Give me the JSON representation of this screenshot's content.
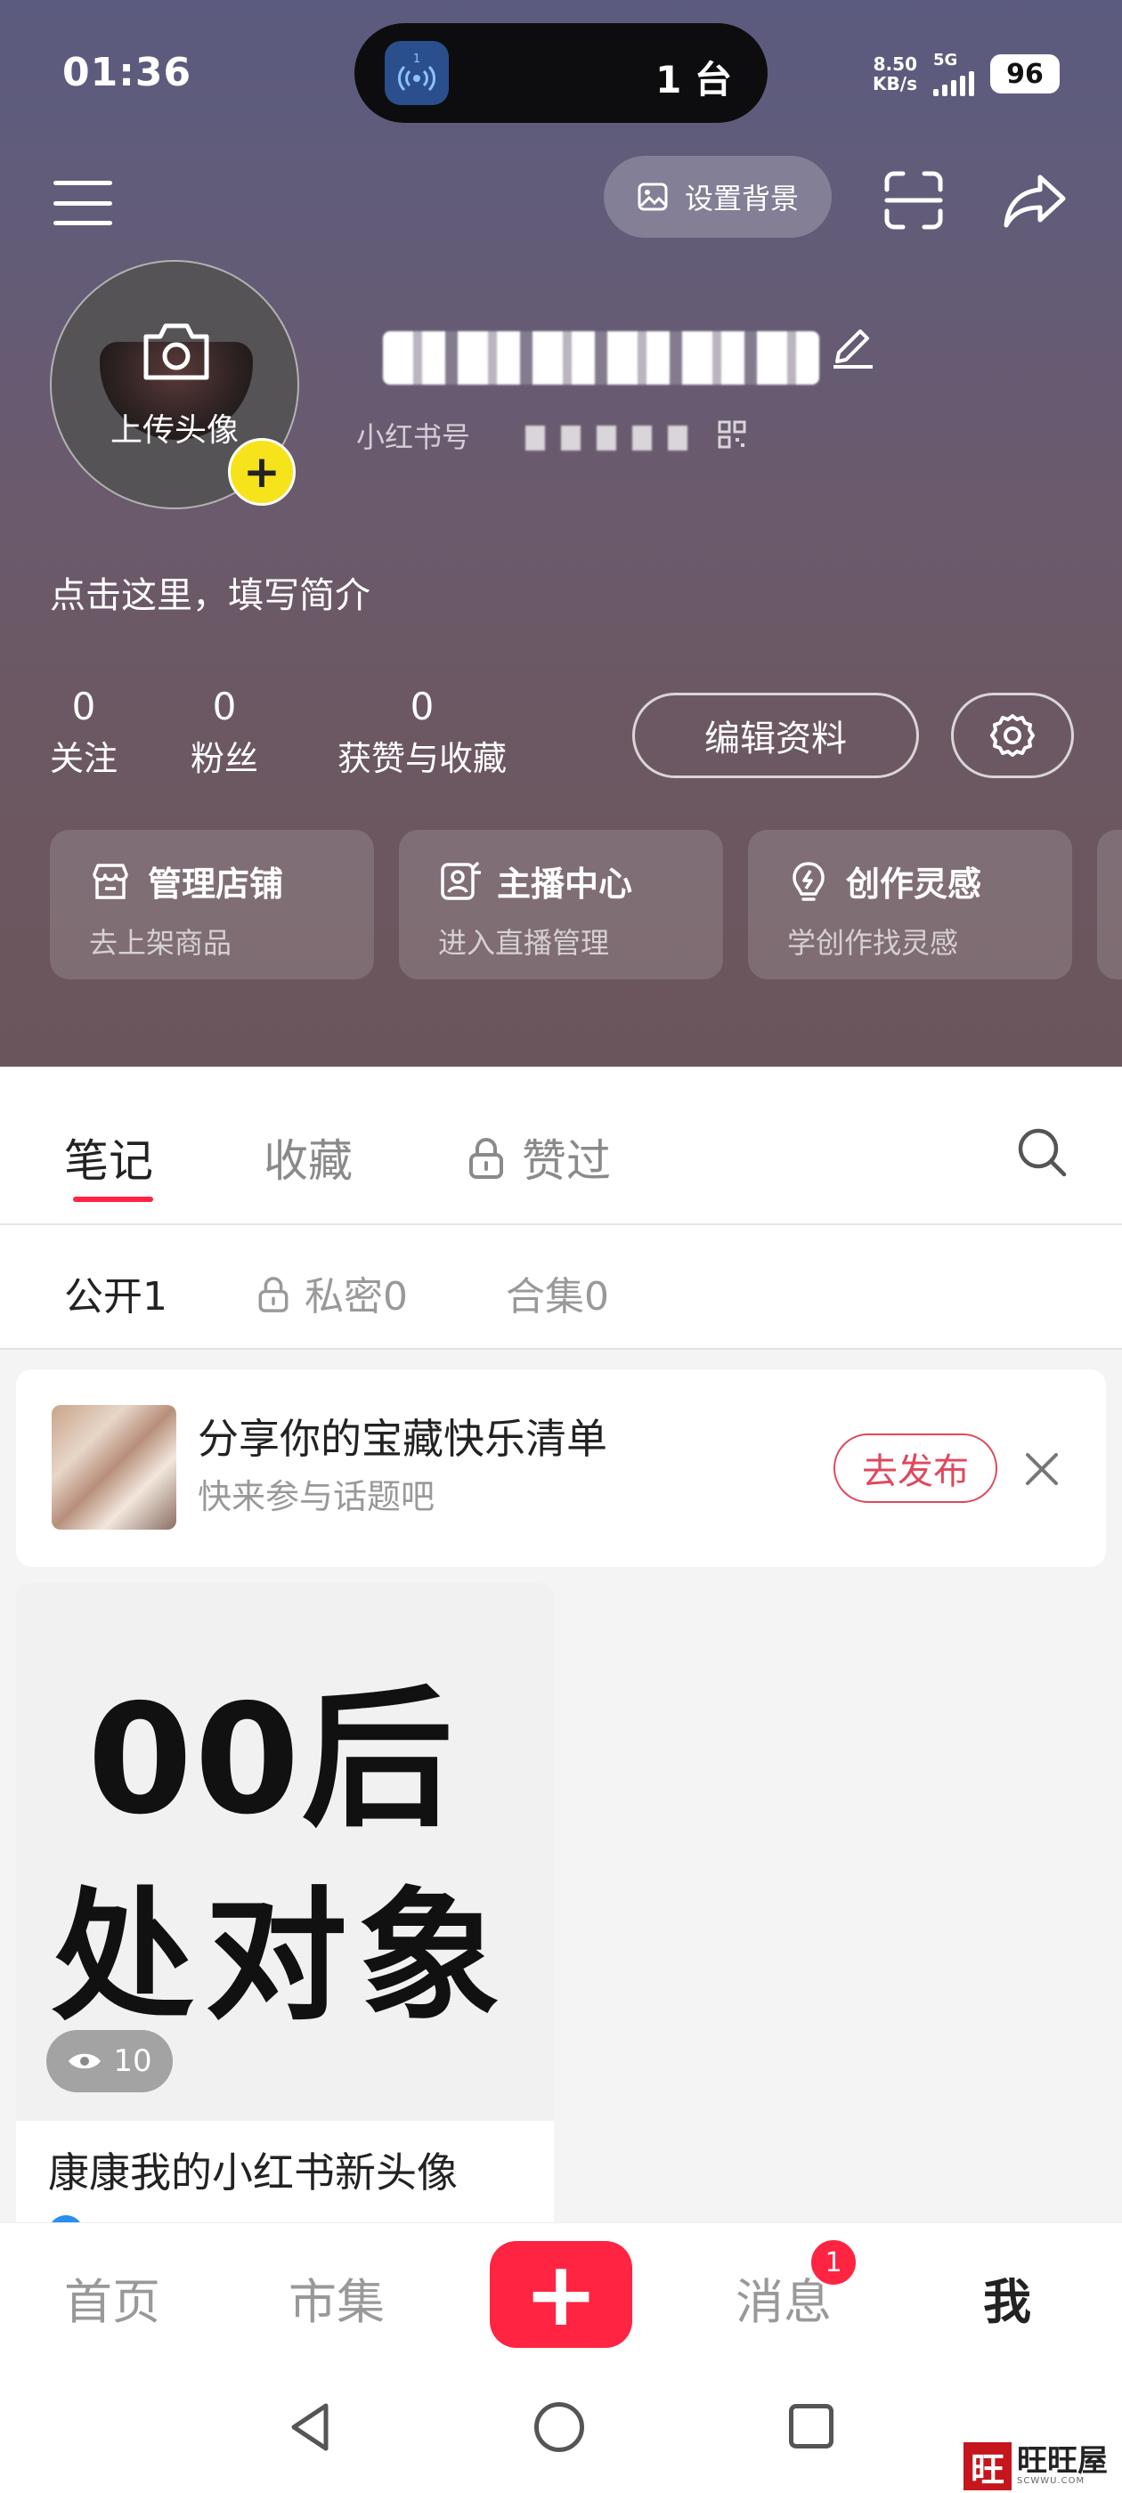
{
  "status": {
    "time": "01:36",
    "island_text": "1 台",
    "island_app_badge": "1",
    "net_speed": "8.50",
    "net_unit": "KB/s",
    "signal": "5G",
    "battery": "96"
  },
  "topbar": {
    "set_background_label": "设置背景"
  },
  "profile": {
    "upload_avatar_label": "上传头像",
    "avatar_plus": "+",
    "redbook_id_label": "小红书号",
    "bio_placeholder": "点击这里，填写简介",
    "stats": [
      {
        "value": "0",
        "label": "关注"
      },
      {
        "value": "0",
        "label": "粉丝"
      },
      {
        "value": "0",
        "label": "获赞与收藏"
      }
    ],
    "edit_profile_label": "编辑资料"
  },
  "shortcuts": [
    {
      "title": "管理店铺",
      "subtitle": "去上架商品",
      "icon": "shop-icon"
    },
    {
      "title": "主播中心",
      "subtitle": "进入直播管理",
      "icon": "anchor-icon"
    },
    {
      "title": "创作灵感",
      "subtitle": "学创作找灵感",
      "icon": "bulb-icon"
    }
  ],
  "tabs": [
    {
      "label": "笔记",
      "active": true
    },
    {
      "label": "收藏",
      "active": false
    },
    {
      "label": "赞过",
      "active": false,
      "locked": true
    }
  ],
  "subtabs": [
    {
      "label": "公开",
      "count": "1",
      "active": true
    },
    {
      "label": "私密",
      "count": "0",
      "locked": true
    },
    {
      "label": "合集",
      "count": "0"
    }
  ],
  "promo": {
    "title": "分享你的宝藏快乐清单",
    "subtitle": "快来参与话题吧",
    "button": "去发布"
  },
  "note": {
    "cover_line1": "00后",
    "cover_line2": "处对象",
    "views": "10",
    "title": "康康我的小红书新头像"
  },
  "bottom_nav": {
    "home": "首页",
    "market": "市集",
    "plus": "+",
    "messages": "消息",
    "messages_badge": "1",
    "me": "我"
  },
  "watermark": {
    "seal": "旺",
    "text": "旺旺屋",
    "site": "SCWWU.COM"
  },
  "colors": {
    "accent": "#ff2442",
    "avatar_plus": "#f7e31b",
    "promo_button": "#e0485c"
  }
}
